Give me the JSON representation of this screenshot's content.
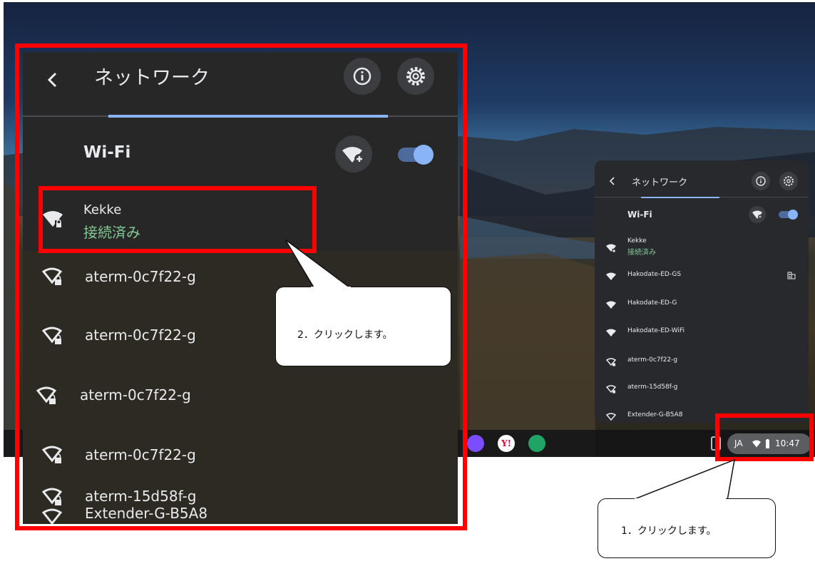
{
  "big_panel": {
    "back_icon": "back-chevron-icon",
    "title": "ネットワーク",
    "info_icon": "info-icon",
    "settings_icon": "gear-icon",
    "wifi_label": "Wi-Fi",
    "add_wifi_icon": "wifi-add-icon",
    "wifi_enabled": true,
    "connected": {
      "name": "Kekke",
      "status": "接続済み"
    },
    "networks": [
      {
        "name": "aterm-0c7f22-g",
        "icon": "wifi-lock-icon"
      },
      {
        "name": "aterm-0c7f22-g",
        "icon": "wifi-lock-icon"
      },
      {
        "name": "aterm-0c7f22-g",
        "icon": "wifi-lock-icon"
      },
      {
        "name": "aterm-0c7f22-g",
        "icon": "wifi-lock-icon"
      },
      {
        "name": "aterm-15d58f-g",
        "icon": "wifi-lock-icon"
      },
      {
        "name": "Extender-G-B5A8",
        "icon": "wifi-icon"
      }
    ]
  },
  "mini_panel": {
    "title": "ネットワーク",
    "wifi_label": "Wi-Fi",
    "connected": {
      "name": "Kekke",
      "status": "接続済み"
    },
    "networks": [
      {
        "name": "Hakodate-ED-GS",
        "icon": "wifi-filled-icon",
        "extra_icon": "building-icon"
      },
      {
        "name": "Hakodate-ED-G",
        "icon": "wifi-filled-icon"
      },
      {
        "name": "Hakodate-ED-WiFi",
        "icon": "wifi-filled-icon"
      },
      {
        "name": "aterm-0c7f22-g",
        "icon": "wifi-lock-icon"
      },
      {
        "name": "aterm-15d58f-g",
        "icon": "wifi-lock-icon"
      },
      {
        "name": "Extender-G-B5A8",
        "icon": "wifi-icon"
      }
    ]
  },
  "tray": {
    "lang": "JA",
    "time": "10:47"
  },
  "callouts": {
    "step1": "1．クリックします。",
    "step2": "2．クリックします。"
  },
  "colors": {
    "accent": "#8ab4f8",
    "connected_green": "#81c995",
    "highlight_red": "#ff0000"
  }
}
